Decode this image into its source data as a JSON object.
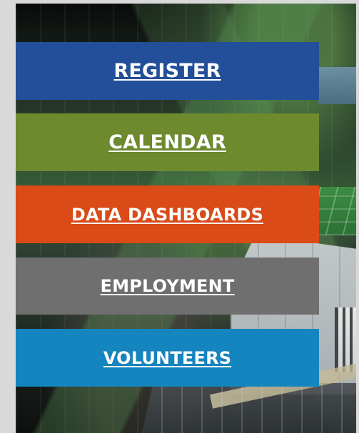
{
  "menu": {
    "items": [
      {
        "label": "REGISTER",
        "color": "#234f9a"
      },
      {
        "label": "CALENDAR",
        "color": "#6d8a2e"
      },
      {
        "label": "DATA DASHBOARDS",
        "color": "#da4b17"
      },
      {
        "label": "EMPLOYMENT",
        "color": "#6f6f6f"
      },
      {
        "label": "VOLUNTEERS",
        "color": "#1585bf"
      }
    ]
  }
}
